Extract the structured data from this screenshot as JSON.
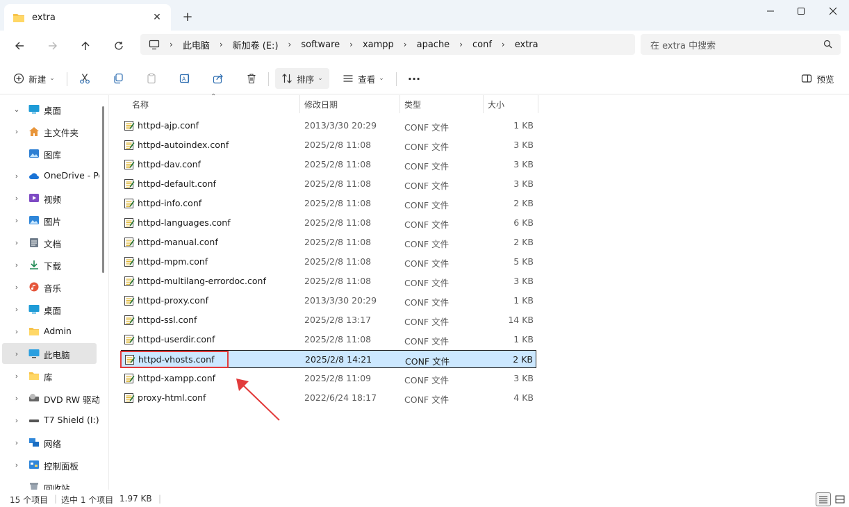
{
  "window": {
    "tab_title": "extra",
    "minimize_icon": "minimize-icon",
    "maximize_icon": "maximize-icon",
    "close_icon": "close-icon"
  },
  "address": {
    "crumbs": [
      "此电脑",
      "新加卷 (E:)",
      "software",
      "xampp",
      "apache",
      "conf",
      "extra"
    ],
    "search_placeholder": "在 extra 中搜索"
  },
  "toolbar": {
    "new_label": "新建",
    "sort_label": "排序",
    "view_label": "查看",
    "more_label": "···",
    "preview_label": "预览"
  },
  "sidebar": {
    "items": [
      {
        "label": "桌面",
        "icon": "desktop-icon",
        "expand": "down"
      },
      {
        "label": "主文件夹",
        "icon": "home-icon",
        "expand": "right"
      },
      {
        "label": "图库",
        "icon": "gallery-icon",
        "expand": ""
      },
      {
        "label": "OneDrive - Pe",
        "icon": "cloud-icon",
        "expand": "right"
      },
      {
        "label": "视频",
        "icon": "video-icon",
        "expand": "right"
      },
      {
        "label": "图片",
        "icon": "pictures-icon",
        "expand": "right"
      },
      {
        "label": "文档",
        "icon": "documents-icon",
        "expand": "right"
      },
      {
        "label": "下载",
        "icon": "download-icon",
        "expand": "right"
      },
      {
        "label": "音乐",
        "icon": "music-icon",
        "expand": "right"
      },
      {
        "label": "桌面",
        "icon": "desktop-icon",
        "expand": "right"
      },
      {
        "label": "Admin",
        "icon": "folder-icon",
        "expand": "right"
      },
      {
        "label": "此电脑",
        "icon": "computer-icon",
        "expand": "right"
      },
      {
        "label": "库",
        "icon": "folder-icon",
        "expand": "right"
      },
      {
        "label": "DVD RW 驱动",
        "icon": "dvd-icon",
        "expand": "right"
      },
      {
        "label": "T7 Shield (I:)",
        "icon": "drive-icon",
        "expand": "right"
      },
      {
        "label": "网络",
        "icon": "network-icon",
        "expand": "right"
      },
      {
        "label": "控制面板",
        "icon": "control-panel-icon",
        "expand": "right"
      },
      {
        "label": "回收站",
        "icon": "recycle-bin-icon",
        "expand": ""
      }
    ]
  },
  "columns": {
    "name": "名称",
    "date": "修改日期",
    "type": "类型",
    "size": "大小"
  },
  "files": [
    {
      "name": "httpd-ajp.conf",
      "date": "2013/3/30 20:29",
      "type": "CONF 文件",
      "size": "1 KB"
    },
    {
      "name": "httpd-autoindex.conf",
      "date": "2025/2/8 11:08",
      "type": "CONF 文件",
      "size": "3 KB"
    },
    {
      "name": "httpd-dav.conf",
      "date": "2025/2/8 11:08",
      "type": "CONF 文件",
      "size": "3 KB"
    },
    {
      "name": "httpd-default.conf",
      "date": "2025/2/8 11:08",
      "type": "CONF 文件",
      "size": "3 KB"
    },
    {
      "name": "httpd-info.conf",
      "date": "2025/2/8 11:08",
      "type": "CONF 文件",
      "size": "2 KB"
    },
    {
      "name": "httpd-languages.conf",
      "date": "2025/2/8 11:08",
      "type": "CONF 文件",
      "size": "6 KB"
    },
    {
      "name": "httpd-manual.conf",
      "date": "2025/2/8 11:08",
      "type": "CONF 文件",
      "size": "2 KB"
    },
    {
      "name": "httpd-mpm.conf",
      "date": "2025/2/8 11:08",
      "type": "CONF 文件",
      "size": "5 KB"
    },
    {
      "name": "httpd-multilang-errordoc.conf",
      "date": "2025/2/8 11:08",
      "type": "CONF 文件",
      "size": "3 KB"
    },
    {
      "name": "httpd-proxy.conf",
      "date": "2013/3/30 20:29",
      "type": "CONF 文件",
      "size": "1 KB"
    },
    {
      "name": "httpd-ssl.conf",
      "date": "2025/2/8 13:17",
      "type": "CONF 文件",
      "size": "14 KB"
    },
    {
      "name": "httpd-userdir.conf",
      "date": "2025/2/8 11:08",
      "type": "CONF 文件",
      "size": "1 KB"
    },
    {
      "name": "httpd-vhosts.conf",
      "date": "2025/2/8 14:21",
      "type": "CONF 文件",
      "size": "2 KB"
    },
    {
      "name": "httpd-xampp.conf",
      "date": "2025/2/8 11:09",
      "type": "CONF 文件",
      "size": "3 KB"
    },
    {
      "name": "proxy-html.conf",
      "date": "2022/6/24 18:17",
      "type": "CONF 文件",
      "size": "4 KB"
    }
  ],
  "selected_file_index": 12,
  "status": {
    "item_count": "15 个项目",
    "selection": "选中 1 个项目",
    "selection_size": "1.97 KB"
  },
  "colors": {
    "accent": "#0067c0",
    "selection": "#cce8ff",
    "annotation": "#e23b3b"
  }
}
